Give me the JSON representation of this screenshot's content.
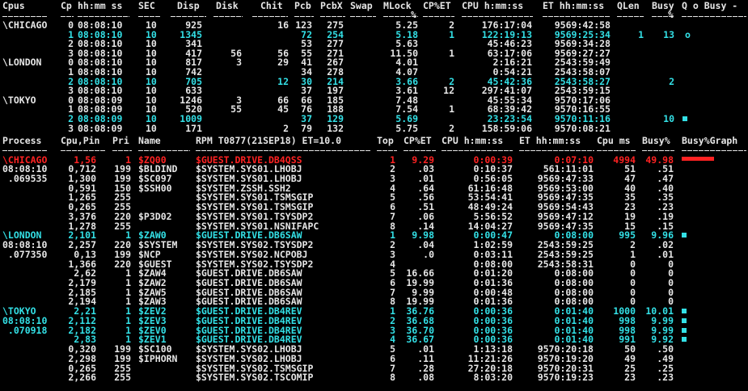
{
  "colors": {
    "white": "#e6e6e6",
    "cyan": "#33e0e6",
    "red": "#ff2222",
    "background": "#000000"
  },
  "cpu_table": {
    "headers": {
      "cpus": "Cpus",
      "cp": "Cp",
      "hhmmss": "hh:mm ss",
      "sec": "SEC",
      "disp": "Disp",
      "disk": "Disk",
      "chit": "Chit",
      "pcb": "Pcb",
      "pcbx": "PcbX",
      "swap": "Swap",
      "mlock": "MLock",
      "cp_et": "CP%ET",
      "cpu_time": "CPU h:mm:ss",
      "et_time": "ET hh:mm:ss",
      "qlen": "QLen",
      "busy": "Busy",
      "q_o_busy": "Q o Busy -"
    },
    "pct_mark": "%",
    "rows": [
      {
        "node": "\\CHICAGO",
        "cp": "0",
        "time": "08:08:10",
        "sec": "10",
        "disp": "925",
        "disk": "",
        "chit": "16",
        "pcb": "123",
        "pcbx": "275",
        "mlock": "5.25",
        "cpet": "2",
        "cpu": "176:17:04",
        "et": "9569:42:58",
        "qlen": "",
        "busy": "",
        "q": "",
        "color": "white"
      },
      {
        "node": "",
        "cp": "1",
        "time": "08:08:10",
        "sec": "10",
        "disp": "1345",
        "disk": "",
        "chit": "",
        "pcb": "72",
        "pcbx": "254",
        "mlock": "5.18",
        "cpet": "1",
        "cpu": "122:19:13",
        "et": "9569:25:34",
        "qlen": "1",
        "busy": "13",
        "q": "o",
        "color": "cyan"
      },
      {
        "node": "",
        "cp": "2",
        "time": "08:08:10",
        "sec": "10",
        "disp": "341",
        "disk": "",
        "chit": "",
        "pcb": "53",
        "pcbx": "277",
        "mlock": "5.63",
        "cpet": "",
        "cpu": "45:46:23",
        "et": "9569:34:28",
        "qlen": "",
        "busy": "",
        "q": "",
        "color": "white"
      },
      {
        "node": "",
        "cp": "3",
        "time": "08:08:10",
        "sec": "10",
        "disp": "417",
        "disk": "56",
        "chit": "56",
        "pcb": "55",
        "pcbx": "271",
        "mlock": "11.50",
        "cpet": "1",
        "cpu": "63:17:06",
        "et": "9569:27:27",
        "qlen": "",
        "busy": "",
        "q": "",
        "color": "white"
      },
      {
        "node": "\\LONDON",
        "cp": "0",
        "time": "08:08:10",
        "sec": "10",
        "disp": "817",
        "disk": "3",
        "chit": "29",
        "pcb": "41",
        "pcbx": "267",
        "mlock": "4.01",
        "cpet": "",
        "cpu": "2:16:21",
        "et": "2543:59:49",
        "qlen": "",
        "busy": "",
        "q": "",
        "color": "white"
      },
      {
        "node": "",
        "cp": "1",
        "time": "08:08:10",
        "sec": "10",
        "disp": "742",
        "disk": "",
        "chit": "",
        "pcb": "34",
        "pcbx": "278",
        "mlock": "4.07",
        "cpet": "",
        "cpu": "0:54:21",
        "et": "2543:58:07",
        "qlen": "",
        "busy": "",
        "q": "",
        "color": "white"
      },
      {
        "node": "",
        "cp": "2",
        "time": "08:08:10",
        "sec": "10",
        "disp": "705",
        "disk": "",
        "chit": "12",
        "pcb": "30",
        "pcbx": "214",
        "mlock": "3.66",
        "cpet": "2",
        "cpu": "45:42:36",
        "et": "2543:58:27",
        "qlen": "",
        "busy": "2",
        "q": "",
        "color": "cyan"
      },
      {
        "node": "",
        "cp": "3",
        "time": "08:08:10",
        "sec": "10",
        "disp": "633",
        "disk": "",
        "chit": "",
        "pcb": "37",
        "pcbx": "197",
        "mlock": "3.61",
        "cpet": "12",
        "cpu": "297:41:07",
        "et": "2543:59:15",
        "qlen": "",
        "busy": "",
        "q": "",
        "color": "white"
      },
      {
        "node": "\\TOKYO",
        "cp": "0",
        "time": "08:08:09",
        "sec": "10",
        "disp": "1246",
        "disk": "3",
        "chit": "66",
        "pcb": "66",
        "pcbx": "185",
        "mlock": "7.48",
        "cpet": "",
        "cpu": "45:55:34",
        "et": "9570:17:06",
        "qlen": "",
        "busy": "",
        "q": "",
        "color": "white"
      },
      {
        "node": "",
        "cp": "1",
        "time": "08:08:09",
        "sec": "10",
        "disp": "520",
        "disk": "55",
        "chit": "45",
        "pcb": "76",
        "pcbx": "188",
        "mlock": "7.54",
        "cpet": "1",
        "cpu": "68:39:42",
        "et": "9570:16:55",
        "qlen": "",
        "busy": "",
        "q": "",
        "color": "white"
      },
      {
        "node": "",
        "cp": "2",
        "time": "08:08:09",
        "sec": "10",
        "disp": "1009",
        "disk": "",
        "chit": "",
        "pcb": "37",
        "pcbx": "129",
        "mlock": "5.69",
        "cpet": "",
        "cpu": "23:23:54",
        "et": "9570:11:16",
        "qlen": "",
        "busy": "10",
        "q": "block",
        "color": "cyan"
      },
      {
        "node": "",
        "cp": "3",
        "time": "08:08:09",
        "sec": "10",
        "disp": "171",
        "disk": "",
        "chit": "2",
        "pcb": "79",
        "pcbx": "132",
        "mlock": "5.75",
        "cpet": "2",
        "cpu": "158:59:06",
        "et": "9570:08:21",
        "qlen": "",
        "busy": "",
        "q": "",
        "color": "white"
      }
    ]
  },
  "proc_table": {
    "headers": {
      "process": "Process",
      "cpu_pin": "Cpu,Pin",
      "pri": "Pri",
      "name": "Name",
      "rpm": "RPM T0877(21SEP18) ET=10.0",
      "top": "Top",
      "cp_et": "CP%ET",
      "cpu_time": "CPU h:mm:ss",
      "et_time": "ET hh:mm:ss",
      "cpu_ms": "Cpu ms",
      "busy_pct": "Busy%",
      "busy_graph": "Busy%Graph"
    },
    "side_labels": [
      {
        "text": "\\CHICAGO",
        "row": 0,
        "color": "red"
      },
      {
        "text": "08:08:10",
        "row": 1,
        "color": "white"
      },
      {
        "text": " .069535",
        "row": 2,
        "color": "white"
      },
      {
        "text": "\\LONDON",
        "row": 8,
        "color": "cyan"
      },
      {
        "text": "08:08:10",
        "row": 9,
        "color": "white"
      },
      {
        "text": " .077350",
        "row": 10,
        "color": "white"
      },
      {
        "text": "\\TOKYO",
        "row": 16,
        "color": "cyan"
      },
      {
        "text": "08:08:10",
        "row": 17,
        "color": "cyan"
      },
      {
        "text": " .070918",
        "row": 18,
        "color": "cyan"
      }
    ],
    "rows": [
      {
        "cpupin": "1,56",
        "pri": "1",
        "name": "$ZQ00",
        "prog": "$GUEST.DRIVE.DB4QSS",
        "top": "1",
        "cpet": "9.29",
        "cpu": "0:00:39",
        "et": "0:07:10",
        "cpums": "4994",
        "busy": "49.98",
        "graph": 0.5,
        "color": "red"
      },
      {
        "cpupin": "0,712",
        "pri": "199",
        "name": "$BLDIND",
        "prog": "$SYSTEM.SYS01.LHOBJ",
        "top": "2",
        "cpet": ".03",
        "cpu": "0:10:37",
        "et": "561:11:01",
        "cpums": "51",
        "busy": ".51",
        "graph": 0,
        "color": "white"
      },
      {
        "cpupin": "1,300",
        "pri": "199",
        "name": "$SC097",
        "prog": "$SYSTEM.SYS01.LHOBJ",
        "top": "3",
        "cpet": ".01",
        "cpu": "0:56:05",
        "et": "9569:47:33",
        "cpums": "47",
        "busy": ".47",
        "graph": 0,
        "color": "white"
      },
      {
        "cpupin": "0,591",
        "pri": "150",
        "name": "$SSH00",
        "prog": "$SYSTEM.ZSSH.SSH2",
        "top": "4",
        "cpet": ".64",
        "cpu": "61:16:48",
        "et": "9569:53:00",
        "cpums": "40",
        "busy": ".40",
        "graph": 0,
        "color": "white"
      },
      {
        "cpupin": "1,265",
        "pri": "255",
        "name": "",
        "prog": "$SYSTEM.SYS01.TSMSGIP",
        "top": "5",
        "cpet": ".56",
        "cpu": "53:54:41",
        "et": "9569:47:35",
        "cpums": "35",
        "busy": ".35",
        "graph": 0,
        "color": "white"
      },
      {
        "cpupin": "0,265",
        "pri": "255",
        "name": "",
        "prog": "$SYSTEM.SYS01.TSMSGIP",
        "top": "6",
        "cpet": ".51",
        "cpu": "48:49:24",
        "et": "9569:54:43",
        "cpums": "23",
        "busy": ".23",
        "graph": 0,
        "color": "white"
      },
      {
        "cpupin": "3,376",
        "pri": "220",
        "name": "$P3D02",
        "prog": "$SYSTEM.SYS01.TSYSDP2",
        "top": "7",
        "cpet": ".06",
        "cpu": "5:56:52",
        "et": "9569:47:12",
        "cpums": "19",
        "busy": ".19",
        "graph": 0,
        "color": "white"
      },
      {
        "cpupin": "1,278",
        "pri": "255",
        "name": "",
        "prog": "$SYSTEM.SYS01.NSNIFAPC",
        "top": "8",
        "cpet": ".14",
        "cpu": "14:04:27",
        "et": "9569:47:35",
        "cpums": "15",
        "busy": ".15",
        "graph": 0,
        "color": "white"
      },
      {
        "cpupin": "2,101",
        "pri": "1",
        "name": "$ZAW0",
        "prog": "$GUEST.DRIVE.DB6SAW",
        "top": "1",
        "cpet": "9.98",
        "cpu": "0:00:47",
        "et": "0:08:00",
        "cpums": "995",
        "busy": "9.96",
        "graph": 0.1,
        "color": "cyan"
      },
      {
        "cpupin": "2,257",
        "pri": "220",
        "name": "$SYSTEM",
        "prog": "$SYSTEM.SYS02.TSYSDP2",
        "top": "2",
        "cpet": ".04",
        "cpu": "1:02:59",
        "et": "2543:59:25",
        "cpums": "2",
        "busy": ".02",
        "graph": 0,
        "color": "white"
      },
      {
        "cpupin": "0,13",
        "pri": "199",
        "name": "$NCP",
        "prog": "$SYSTEM.SYS02.NCPOBJ",
        "top": "3",
        "cpet": ".0",
        "cpu": "0:03:11",
        "et": "2543:59:25",
        "cpums": "1",
        "busy": ".01",
        "graph": 0,
        "color": "white"
      },
      {
        "cpupin": "1,366",
        "pri": "220",
        "name": "$GUEST",
        "prog": "$SYSTEM.SYS02.TSYSDP2",
        "top": "4",
        "cpet": "",
        "cpu": "0:08:00",
        "et": "2543:58:31",
        "cpums": "0",
        "busy": "0",
        "graph": 0,
        "color": "white"
      },
      {
        "cpupin": "2,62",
        "pri": "1",
        "name": "$ZAW4",
        "prog": "$GUEST.DRIVE.DB6SAW",
        "top": "5",
        "cpet": "16.66",
        "cpu": "0:01:20",
        "et": "0:08:00",
        "cpums": "0",
        "busy": "0",
        "graph": 0,
        "color": "white"
      },
      {
        "cpupin": "2,179",
        "pri": "1",
        "name": "$ZAW2",
        "prog": "$GUEST.DRIVE.DB6SAW",
        "top": "6",
        "cpet": "19.99",
        "cpu": "0:01:36",
        "et": "0:08:00",
        "cpums": "0",
        "busy": "0",
        "graph": 0,
        "color": "white"
      },
      {
        "cpupin": "2,185",
        "pri": "1",
        "name": "$ZAW5",
        "prog": "$GUEST.DRIVE.DB6SAW",
        "top": "7",
        "cpet": "9.99",
        "cpu": "0:00:48",
        "et": "0:08:00",
        "cpums": "0",
        "busy": "0",
        "graph": 0,
        "color": "white"
      },
      {
        "cpupin": "2,194",
        "pri": "1",
        "name": "$ZAW3",
        "prog": "$GUEST.DRIVE.DB6SAW",
        "top": "8",
        "cpet": "19.99",
        "cpu": "0:01:36",
        "et": "0:08:00",
        "cpums": "0",
        "busy": "0",
        "graph": 0,
        "color": "white"
      },
      {
        "cpupin": "2,21",
        "pri": "1",
        "name": "$ZEV2",
        "prog": "$GUEST.DRIVE.DB4REV",
        "top": "1",
        "cpet": "36.76",
        "cpu": "0:00:36",
        "et": "0:01:40",
        "cpums": "1000",
        "busy": "10.01",
        "graph": 0.1,
        "color": "cyan"
      },
      {
        "cpupin": "2,112",
        "pri": "1",
        "name": "$ZEV3",
        "prog": "$GUEST.DRIVE.DB4REV",
        "top": "2",
        "cpet": "36.68",
        "cpu": "0:00:36",
        "et": "0:01:40",
        "cpums": "998",
        "busy": "9.99",
        "graph": 0.1,
        "color": "cyan"
      },
      {
        "cpupin": "2,182",
        "pri": "1",
        "name": "$ZEV0",
        "prog": "$GUEST.DRIVE.DB4REV",
        "top": "3",
        "cpet": "36.70",
        "cpu": "0:00:36",
        "et": "0:01:40",
        "cpums": "998",
        "busy": "9.99",
        "graph": 0.1,
        "color": "cyan"
      },
      {
        "cpupin": "2,83",
        "pri": "1",
        "name": "$ZEV1",
        "prog": "$GUEST.DRIVE.DB4REV",
        "top": "4",
        "cpet": "36.67",
        "cpu": "0:00:36",
        "et": "0:01:40",
        "cpums": "991",
        "busy": "9.92",
        "graph": 0.1,
        "color": "cyan"
      },
      {
        "cpupin": "0,320",
        "pri": "199",
        "name": "$SC100",
        "prog": "$SYSTEM.SYS02.LHOBJ",
        "top": "5",
        "cpet": ".01",
        "cpu": "1:13:18",
        "et": "9570:20:18",
        "cpums": "50",
        "busy": ".50",
        "graph": 0,
        "color": "white"
      },
      {
        "cpupin": "2,298",
        "pri": "199",
        "name": "$IPHORN",
        "prog": "$SYSTEM.SYS02.LHOBJ",
        "top": "6",
        "cpet": ".11",
        "cpu": "11:21:26",
        "et": "9570:19:20",
        "cpums": "49",
        "busy": ".49",
        "graph": 0,
        "color": "white"
      },
      {
        "cpupin": "0,265",
        "pri": "255",
        "name": "",
        "prog": "$SYSTEM.SYS02.TSMSGIP",
        "top": "7",
        "cpet": ".28",
        "cpu": "27:20:18",
        "et": "9570:20:31",
        "cpums": "25",
        "busy": ".25",
        "graph": 0,
        "color": "white"
      },
      {
        "cpupin": "2,266",
        "pri": "255",
        "name": "",
        "prog": "$SYSTEM.SYS02.TSCOMIP",
        "top": "8",
        "cpet": ".08",
        "cpu": "8:03:20",
        "et": "9570:19:23",
        "cpums": "23",
        "busy": ".23",
        "graph": 0,
        "color": "white"
      }
    ]
  }
}
